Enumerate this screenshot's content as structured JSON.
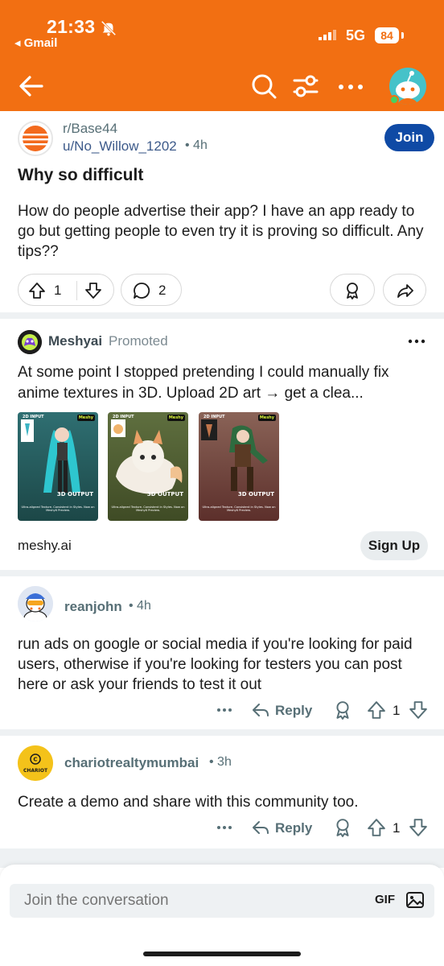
{
  "status_bar": {
    "time": "21:33",
    "back_app": "◂ Gmail",
    "network": "5G",
    "battery": "84"
  },
  "post": {
    "subreddit": "r/Base44",
    "user": "u/No_Willow_1202",
    "time": "• 4h",
    "join_label": "Join",
    "title": "Why so difficult",
    "body": "How do people advertise their app? I have an app ready to go but getting people to even try it is proving so difficult. Any tips??",
    "votes": "1",
    "comments": "2"
  },
  "ad": {
    "name": "Meshyai",
    "promoted": "Promoted",
    "text": "At some point I stopped pretending I could manually fix anime textures in 3D. Upload 2D art → get a clea...",
    "domain": "meshy.ai",
    "signup_label": "Sign Up",
    "cards": [
      {
        "top_left": "2D INPUT",
        "top_right": "Meshy",
        "output": "3D OUTPUT",
        "caption": "Ultra-aligned Texture. Consistent in Styles. Now on Meshy6 Preview."
      },
      {
        "top_left": "2D INPUT",
        "top_right": "Meshy",
        "output": "3D OUTPUT",
        "caption": "Ultra-aligned Texture. Consistent in Styles. Now on Meshy6 Preview."
      },
      {
        "top_left": "2D INPUT",
        "top_right": "Meshy",
        "output": "3D OUTPUT",
        "caption": "Ultra-aligned Texture. Consistent in Styles. Now on Meshy6 Preview."
      }
    ]
  },
  "comments": [
    {
      "user": "reanjohn",
      "time": "• 4h",
      "body": "run ads on google or social media if you're looking for paid users, otherwise if you're looking for testers you can post here or ask your friends to test it out",
      "reply_label": "Reply",
      "votes": "1"
    },
    {
      "user": "chariotrealtymumbai",
      "time": "• 3h",
      "body": "Create a demo and share with this community too.",
      "reply_label": "Reply",
      "votes": "1",
      "avatar_text": "CHARIOT"
    }
  ],
  "composer": {
    "placeholder": "Join the conversation",
    "gif_label": "GIF"
  },
  "colors": {
    "brand_orange": "#f26f12",
    "join_blue": "#0f4aa5",
    "link_blue": "#3d5a8a"
  }
}
